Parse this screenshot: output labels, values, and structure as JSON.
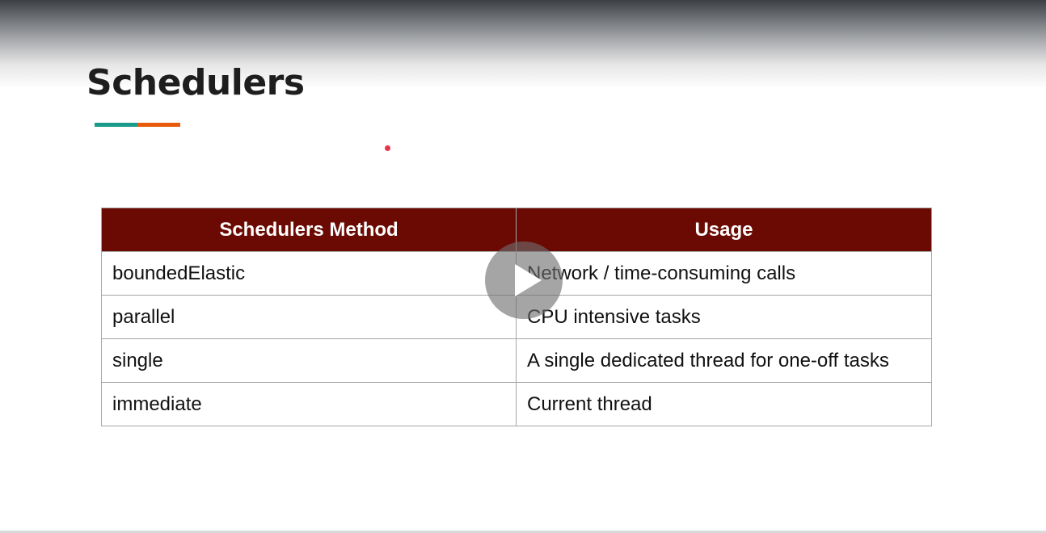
{
  "slide": {
    "title": "Schedulers"
  },
  "colors": {
    "accent_teal": "#1a9a8a",
    "accent_orange": "#e8590c",
    "table_header_bg": "#6b0a03",
    "laser_dot": "#e8334a"
  },
  "table": {
    "headers": [
      "Schedulers Method",
      "Usage"
    ],
    "rows": [
      [
        "boundedElastic",
        "Network / time-consuming calls"
      ],
      [
        "parallel",
        "CPU intensive tasks"
      ],
      [
        "single",
        "A single dedicated thread for one-off tasks"
      ],
      [
        "immediate",
        "Current thread"
      ]
    ]
  },
  "player": {
    "play_icon": "play-icon"
  }
}
